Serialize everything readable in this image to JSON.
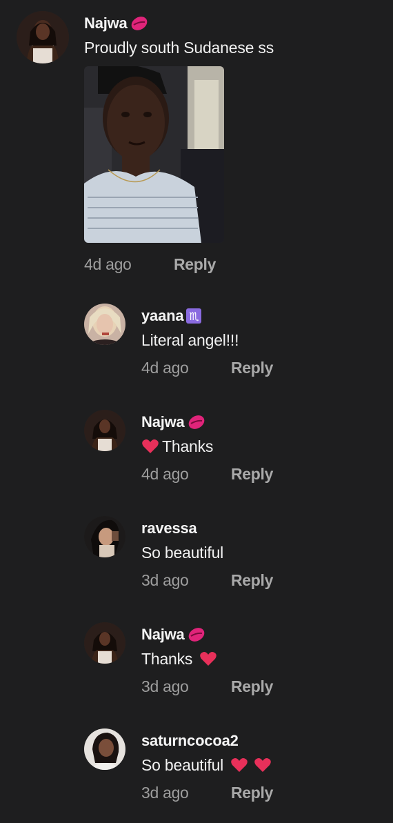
{
  "comments": [
    {
      "username": "Najwa",
      "badge": "kiss-mark-icon",
      "text": "Proudly south Sudanese ss",
      "time": "4d ago",
      "reply": "Reply"
    },
    {
      "username": "yaana",
      "badge": "♏",
      "text": "Literal angel!!!",
      "time": "4d ago",
      "reply": "Reply"
    },
    {
      "username": "Najwa",
      "badge": "kiss-mark-icon",
      "text": "Thanks",
      "time": "4d ago",
      "reply": "Reply"
    },
    {
      "username": "ravessa",
      "text": "So beautiful",
      "time": "3d ago",
      "reply": "Reply"
    },
    {
      "username": "Najwa",
      "badge": "kiss-mark-icon",
      "text": "Thanks",
      "time": "3d ago",
      "reply": "Reply"
    },
    {
      "username": "saturncocoa2",
      "text": "So beautiful",
      "time": "3d ago",
      "reply": "Reply"
    }
  ],
  "colors": {
    "background": "#1e1e1f",
    "username": "#f4f4f4",
    "meta": "#9e9e9e",
    "heart": "#e8305a",
    "kiss": "#e0247a"
  }
}
